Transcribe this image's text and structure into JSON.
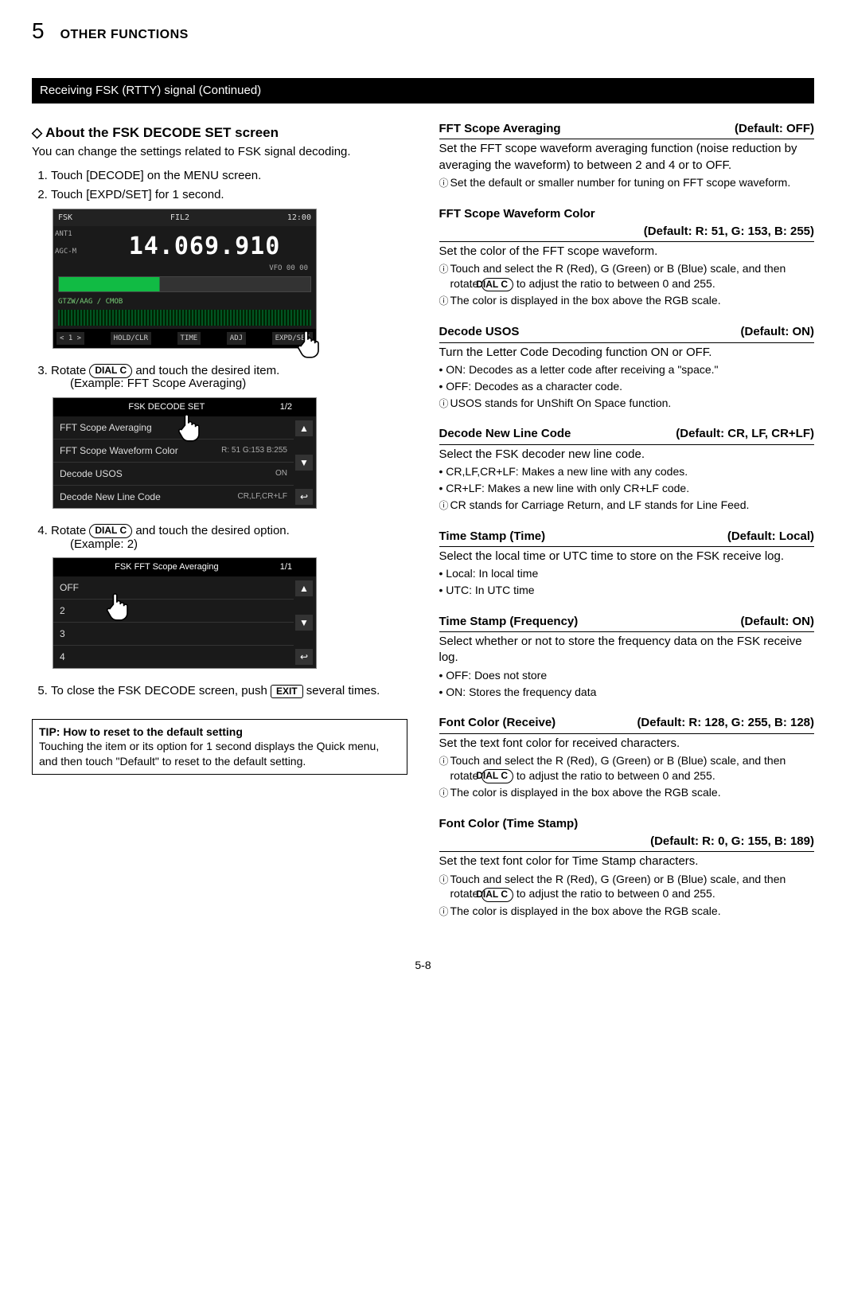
{
  "chapter": {
    "num": "5",
    "title": "OTHER FUNCTIONS"
  },
  "bar": "Receiving FSK (RTTY) signal (Continued)",
  "left": {
    "heading": "◇ About the FSK DECODE SET screen",
    "intro": "You can change the settings related to FSK signal decoding.",
    "steps": {
      "s1": "Touch [DECODE] on the MENU screen.",
      "s2": "Touch [EXPD/SET] for 1 second.",
      "s3a": "Rotate ",
      "s3b": " and touch the desired item.",
      "s3ex": "(Example: FFT Scope Averaging)",
      "s4a": "Rotate ",
      "s4b": " and touch the desired option.",
      "s4ex": "(Example: 2)",
      "s5a": "To close the ",
      "s5screen": "FSK DECODE",
      "s5b": " screen, push ",
      "s5c": " several times."
    },
    "keys": {
      "dialc": "DIAL C",
      "exit": "EXIT"
    },
    "ss1": {
      "tl": "FSK",
      "fil": "FIL2",
      "time": "12:00",
      "ant": "ANT1",
      "agc": "AGC-M",
      "freq": "14.069.910",
      "vfo": "VFO",
      "band": "00 00",
      "wf": "GTZW/AAG / CMOB",
      "b1": "< 1 >",
      "b2": "HOLD/CLR",
      "b3": "TIME",
      "b4": "ADJ",
      "b5": "EXPD/SET"
    },
    "ss2": {
      "title": "FSK DECODE SET",
      "page": "1/2",
      "r1": "FFT Scope Averaging",
      "r2": "FFT Scope Waveform Color",
      "r2v": "R: 51 G:153 B:255",
      "r3": "Decode USOS",
      "r3v": "ON",
      "r4": "Decode New Line Code",
      "r4v": "CR,LF,CR+LF",
      "up": "▲",
      "dn": "▼",
      "back": "↩"
    },
    "ss3": {
      "title": "FSK FFT Scope Averaging",
      "page": "1/1",
      "r1": "OFF",
      "r2": "2",
      "r3": "3",
      "r4": "4",
      "up": "▲",
      "dn": "▼",
      "back": "↩"
    },
    "tip": {
      "head": "TIP: How to reset to the default setting",
      "body": "Touching the item or its option for 1 second displays the Quick menu, and then touch \"Default\" to reset to the default setting."
    }
  },
  "right": {
    "fftavg": {
      "name": "FFT Scope Averaging",
      "def": "(Default: OFF)",
      "body": "Set the FFT scope waveform averaging function (noise reduction by averaging the waveform) to between 2 and 4 or to OFF.",
      "info": "Set the default or smaller number for tuning on FFT scope waveform."
    },
    "fftcol": {
      "name": "FFT Scope Waveform Color",
      "def": "(Default: R: 51, G: 153, B: 255)",
      "body": "Set the color of the FFT scope waveform.",
      "info1a": "Touch and select the R (Red), G (Green) or B (Blue) scale, and then rotate ",
      "info1b": " to adjust the ratio to between 0 and 255.",
      "info2": "The color is displayed in the box above the RGB scale."
    },
    "usos": {
      "name": "Decode USOS",
      "def": "(Default: ON)",
      "body": "Turn the Letter Code Decoding function ON or OFF.",
      "b1": "• ON: Decodes as a letter code after receiving a \"space.\"",
      "b2": "• OFF: Decodes as a character code.",
      "info": "USOS stands for UnShift On Space function."
    },
    "newline": {
      "name": "Decode New Line Code",
      "def": "(Default: CR, LF, CR+LF)",
      "body": "Select the FSK decoder new line code.",
      "b1": "• CR,LF,CR+LF: Makes a new line with any codes.",
      "b2": "• CR+LF: Makes a new line with only CR+LF code.",
      "info": "CR stands for Carriage Return, and LF stands for Line Feed."
    },
    "tstime": {
      "name": "Time Stamp (Time)",
      "def": "(Default: Local)",
      "body": "Select the local time or UTC time to store on the FSK receive log.",
      "b1": "• Local: In local time",
      "b2": "• UTC: In UTC time"
    },
    "tsfreq": {
      "name": "Time Stamp (Frequency)",
      "def": "(Default: ON)",
      "body": "Select whether or not to store the frequency data on the FSK receive log.",
      "b1": "• OFF: Does not store",
      "b2": "• ON: Stores the frequency data"
    },
    "fcrecv": {
      "name": "Font Color (Receive)",
      "def": "(Default: R: 128, G: 255, B: 128)",
      "body": "Set the text font color for received characters.",
      "info1a": "Touch and select the R (Red), G (Green) or B (Blue) scale, and then rotate ",
      "info1b": " to adjust the ratio to between 0 and 255.",
      "info2": "The color is displayed in the box above the RGB scale."
    },
    "fcts": {
      "name": "Font Color (Time Stamp)",
      "def": "(Default: R: 0, G: 155, B: 189)",
      "body": "Set the text font color for Time Stamp characters.",
      "info1a": "Touch and select the R (Red), G (Green) or B (Blue) scale, and then rotate ",
      "info1b": " to adjust the ratio to between 0 and 255.",
      "info2": "The color is displayed in the box above the RGB scale."
    }
  },
  "footer": "5-8"
}
